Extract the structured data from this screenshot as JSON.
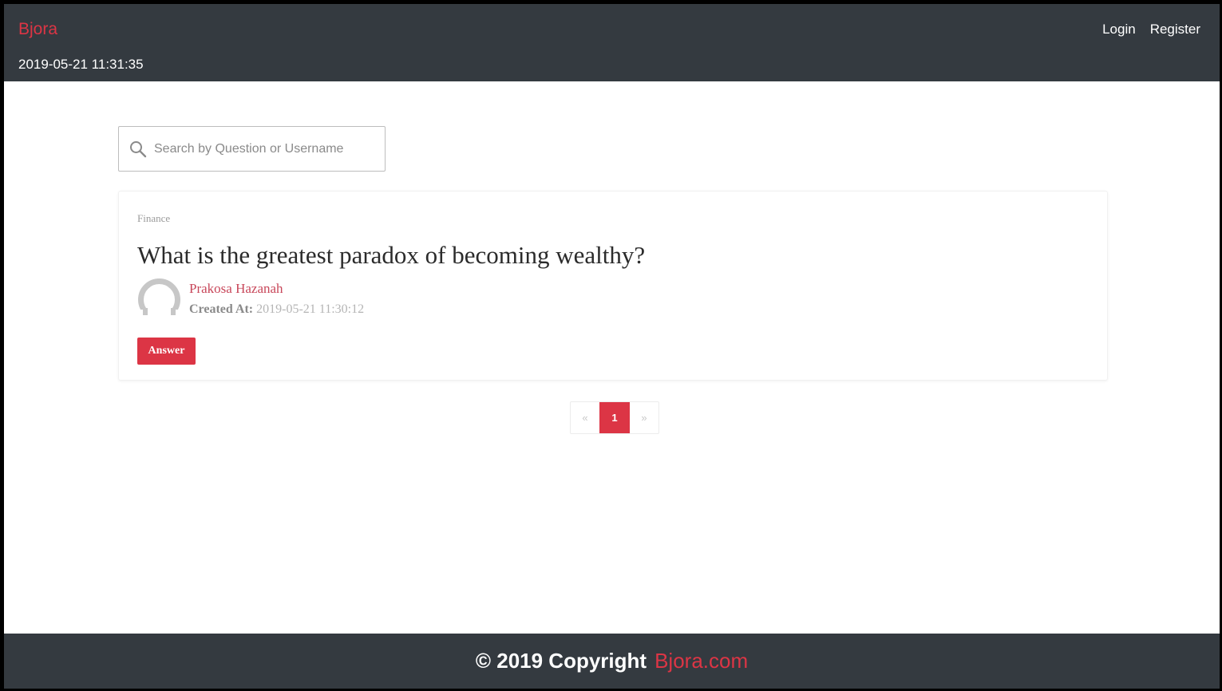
{
  "header": {
    "brand": "Bjora",
    "datetime": "2019-05-21 11:31:35",
    "nav": {
      "login": "Login",
      "register": "Register"
    }
  },
  "search": {
    "placeholder": "Search by Question or Username",
    "value": ""
  },
  "question_card": {
    "category": "Finance",
    "title": "What is the greatest paradox of becoming wealthy?",
    "author": "Prakosa Hazanah",
    "created_label": "Created At:",
    "created_value": "2019-05-21 11:30:12",
    "answer_label": "Answer"
  },
  "pagination": {
    "prev": "«",
    "current": "1",
    "next": "»"
  },
  "footer": {
    "text": "© 2019 Copyright",
    "link": "Bjora.com"
  },
  "colors": {
    "accent": "#dc3545",
    "navbar": "#343a40"
  },
  "icons": {
    "search": "search-icon",
    "avatar": "user-avatar-icon"
  }
}
